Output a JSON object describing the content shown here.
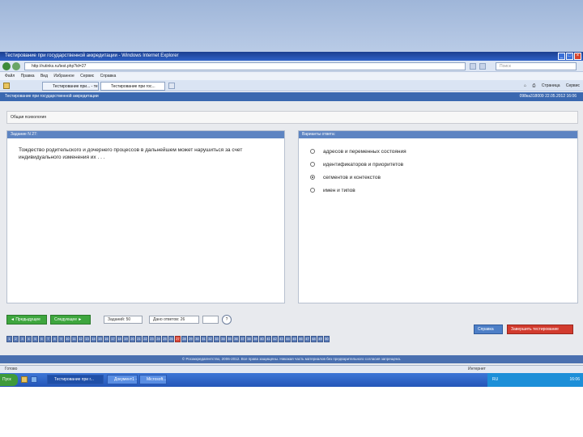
{
  "window": {
    "title": "Тестирование при государственной аккредитации - Windows Internet Explorer",
    "url": "http://rutinks.ru/test.php?id=27",
    "search_placeholder": "Поиск"
  },
  "menu": [
    "Файл",
    "Правка",
    "Вид",
    "Избранное",
    "Сервис",
    "Справка"
  ],
  "tabs": [
    {
      "label": "Тестирование при... - тестов",
      "active": false
    },
    {
      "label": "Тестирование при гос...",
      "active": true
    }
  ],
  "toolbar_tools": [
    "Страница",
    "Сервис"
  ],
  "app": {
    "header_title": "Тестирование при государственной аккредитации",
    "header_right": "098ка318009 22.05.2012 16:06",
    "topic": "Общая психология"
  },
  "question_panel": {
    "heading": "Задание N 27:",
    "text": "Тождество родительского и дочернего процессов в дальнейшем может нарушиться за счет индивидуального изменения их . . ."
  },
  "answers_panel": {
    "heading": "Варианты ответа:",
    "options": [
      {
        "text": "адресов и переменных состояния",
        "checked": false
      },
      {
        "text": "идентификаторов и приоритетов",
        "checked": false
      },
      {
        "text": "сегментов и контекстов",
        "checked": true
      },
      {
        "text": "имен и типов",
        "checked": false
      }
    ]
  },
  "controls": {
    "prev_label": "◄ Предыдущее",
    "next_label": "Следующее ►",
    "task_info": "Заданий: 50",
    "answered_info": "Дано ответов: 26",
    "circle_label": "?"
  },
  "question_numbers": [
    "1",
    "2",
    "3",
    "4",
    "5",
    "6",
    "7",
    "8",
    "9",
    "10",
    "11",
    "12",
    "13",
    "14",
    "15",
    "16",
    "17",
    "18",
    "19",
    "20",
    "21",
    "22",
    "23",
    "24",
    "25",
    "26",
    "27",
    "28",
    "29",
    "30",
    "31",
    "32",
    "33",
    "34",
    "35",
    "36",
    "37",
    "38",
    "39",
    "40",
    "41",
    "42",
    "43",
    "44",
    "45",
    "46",
    "47",
    "48",
    "49",
    "50"
  ],
  "current_question": "27",
  "buttons": {
    "help_label": "Справка",
    "finish_label": "Завершить тестирование"
  },
  "footer_text": "© Росаккредагентство, 2006-2012. Все права защищены. Никакая часть материалов без предварительного согласия запрещена.",
  "statusbar": {
    "left": "Готово",
    "zone": "Интернет"
  },
  "taskbar": {
    "start_label": "Пуск",
    "tasks": [
      {
        "label": "Тестирование при г...",
        "active": true
      },
      {
        "label": "Документ1 - Micr...",
        "active": false
      },
      {
        "label": "Microsoft...",
        "active": false
      }
    ],
    "tray_lang": "RU",
    "clock": "16:06"
  },
  "colors": {
    "header_blue": "#3a68b0",
    "panel_head": "#5d84c2",
    "nav_green": "#3ea63e",
    "finish_red": "#d23b2e",
    "current_q": "#d94a3c"
  }
}
